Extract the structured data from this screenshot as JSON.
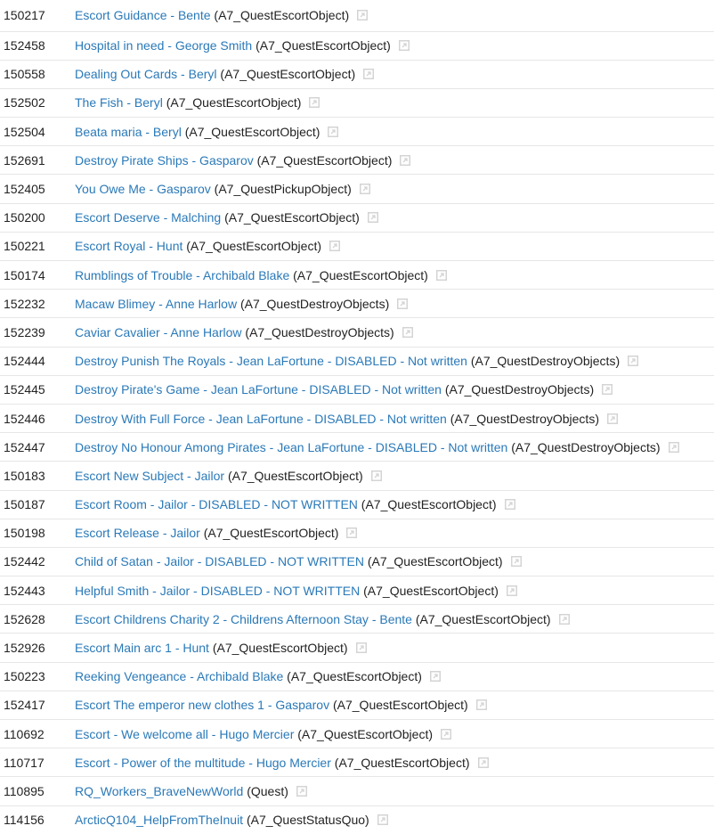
{
  "colors": {
    "link": "#2a79b8",
    "text": "#222222",
    "row_border": "#e6e6e6",
    "icon": "#d4d4d4"
  },
  "rows": [
    {
      "id": "150217",
      "name": "Escort Guidance - Bente",
      "type": "(A7_QuestEscortObject)",
      "icon": "external-link-icon"
    },
    {
      "id": "152458",
      "name": "Hospital in need - George Smith",
      "type": "(A7_QuestEscortObject)",
      "icon": "external-link-icon"
    },
    {
      "id": "150558",
      "name": "Dealing Out Cards - Beryl",
      "type": "(A7_QuestEscortObject)",
      "icon": "external-link-icon"
    },
    {
      "id": "152502",
      "name": "The Fish - Beryl",
      "type": "(A7_QuestEscortObject)",
      "icon": "external-link-icon"
    },
    {
      "id": "152504",
      "name": "Beata maria - Beryl",
      "type": "(A7_QuestEscortObject)",
      "icon": "external-link-icon"
    },
    {
      "id": "152691",
      "name": "Destroy Pirate Ships - Gasparov",
      "type": "(A7_QuestEscortObject)",
      "icon": "external-link-icon"
    },
    {
      "id": "152405",
      "name": "You Owe Me - Gasparov",
      "type": "(A7_QuestPickupObject)",
      "icon": "external-link-icon"
    },
    {
      "id": "150200",
      "name": "Escort Deserve - Malching",
      "type": "(A7_QuestEscortObject)",
      "icon": "external-link-icon"
    },
    {
      "id": "150221",
      "name": "Escort Royal - Hunt",
      "type": "(A7_QuestEscortObject)",
      "icon": "external-link-icon"
    },
    {
      "id": "150174",
      "name": "Rumblings of Trouble - Archibald Blake",
      "type": "(A7_QuestEscortObject)",
      "icon": "external-link-icon"
    },
    {
      "id": "152232",
      "name": "Macaw Blimey - Anne Harlow",
      "type": "(A7_QuestDestroyObjects)",
      "icon": "external-link-icon"
    },
    {
      "id": "152239",
      "name": "Caviar Cavalier - Anne Harlow",
      "type": "(A7_QuestDestroyObjects)",
      "icon": "external-link-icon"
    },
    {
      "id": "152444",
      "name": "Destroy Punish The Royals - Jean LaFortune - DISABLED - Not written",
      "type": "(A7_QuestDestroyObjects)",
      "icon": "external-link-icon"
    },
    {
      "id": "152445",
      "name": "Destroy Pirate's Game - Jean LaFortune - DISABLED - Not written",
      "type": "(A7_QuestDestroyObjects)",
      "icon": "external-link-icon"
    },
    {
      "id": "152446",
      "name": "Destroy With Full Force - Jean LaFortune - DISABLED - Not written",
      "type": "(A7_QuestDestroyObjects)",
      "icon": "external-link-icon"
    },
    {
      "id": "152447",
      "name": "Destroy No Honour Among Pirates - Jean LaFortune - DISABLED - Not written",
      "type": "(A7_QuestDestroyObjects)",
      "icon": "external-link-icon"
    },
    {
      "id": "150183",
      "name": "Escort New Subject - Jailor",
      "type": "(A7_QuestEscortObject)",
      "icon": "external-link-icon"
    },
    {
      "id": "150187",
      "name": "Escort Room - Jailor - DISABLED - NOT WRITTEN",
      "type": "(A7_QuestEscortObject)",
      "icon": "external-link-icon"
    },
    {
      "id": "150198",
      "name": "Escort Release - Jailor",
      "type": "(A7_QuestEscortObject)",
      "icon": "external-link-icon"
    },
    {
      "id": "152442",
      "name": "Child of Satan - Jailor - DISABLED - NOT WRITTEN",
      "type": "(A7_QuestEscortObject)",
      "icon": "external-link-icon"
    },
    {
      "id": "152443",
      "name": "Helpful Smith - Jailor - DISABLED - NOT WRITTEN",
      "type": "(A7_QuestEscortObject)",
      "icon": "external-link-icon"
    },
    {
      "id": "152628",
      "name": "Escort Childrens Charity 2 - Childrens Afternoon Stay - Bente",
      "type": "(A7_QuestEscortObject)",
      "icon": "external-link-icon"
    },
    {
      "id": "152926",
      "name": "Escort Main arc 1 - Hunt",
      "type": "(A7_QuestEscortObject)",
      "icon": "external-link-icon"
    },
    {
      "id": "150223",
      "name": "Reeking Vengeance - Archibald Blake",
      "type": "(A7_QuestEscortObject)",
      "icon": "external-link-icon"
    },
    {
      "id": "152417",
      "name": "Escort The emperor new clothes 1 - Gasparov",
      "type": "(A7_QuestEscortObject)",
      "icon": "external-link-icon"
    },
    {
      "id": "110692",
      "name": "Escort - We welcome all - Hugo Mercier",
      "type": "(A7_QuestEscortObject)",
      "icon": "external-link-icon"
    },
    {
      "id": "110717",
      "name": "Escort - Power of the multitude - Hugo Mercier",
      "type": "(A7_QuestEscortObject)",
      "icon": "external-link-icon"
    },
    {
      "id": "110895",
      "name": "RQ_Workers_BraveNewWorld",
      "type": "(Quest)",
      "icon": "external-link-icon"
    },
    {
      "id": "114156",
      "name": "ArcticQ104_HelpFromTheInuit",
      "type": "(A7_QuestStatusQuo)",
      "icon": "external-link-icon"
    }
  ]
}
